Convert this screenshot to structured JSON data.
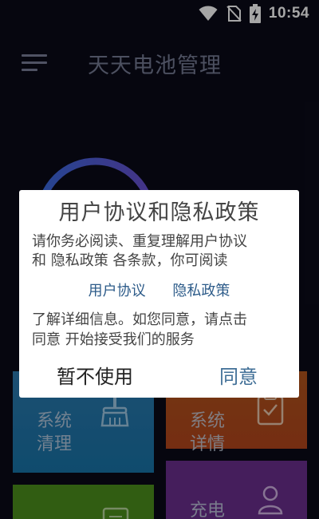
{
  "status_bar": {
    "time": "10:54",
    "icons": [
      "wifi-icon",
      "no-sim-icon",
      "battery-charging-icon"
    ]
  },
  "app_bar": {
    "menu_icon": "hamburger-menu-icon",
    "title": "天天电池管理"
  },
  "gauge": {
    "color": "#3d5bd8"
  },
  "tiles": [
    {
      "label": "系统清理",
      "icon": "broom-icon",
      "color": "#1f77ad"
    },
    {
      "label": "系统详情",
      "icon": "clipboard-check-icon",
      "color": "#b3501c"
    },
    {
      "label": "",
      "icon": "document-icon",
      "color": "#4c8f1c"
    },
    {
      "label": "充电",
      "icon": "user-icon",
      "color": "#6b2f8e"
    }
  ],
  "dialog": {
    "title": "用户协议和隐私政策",
    "body_line1": "请你务必阅读、重复理解用户协议",
    "body_line2": "和 隐私政策 各条款，你可阅读",
    "link_user_agreement": "用户协议",
    "link_privacy_policy": "隐私政策",
    "body_line3": "了解详细信息。如您同意，请点击",
    "body_line4": "同意 开始接受我们的服务",
    "decline_label": "暂不使用",
    "agree_label": "同意"
  }
}
